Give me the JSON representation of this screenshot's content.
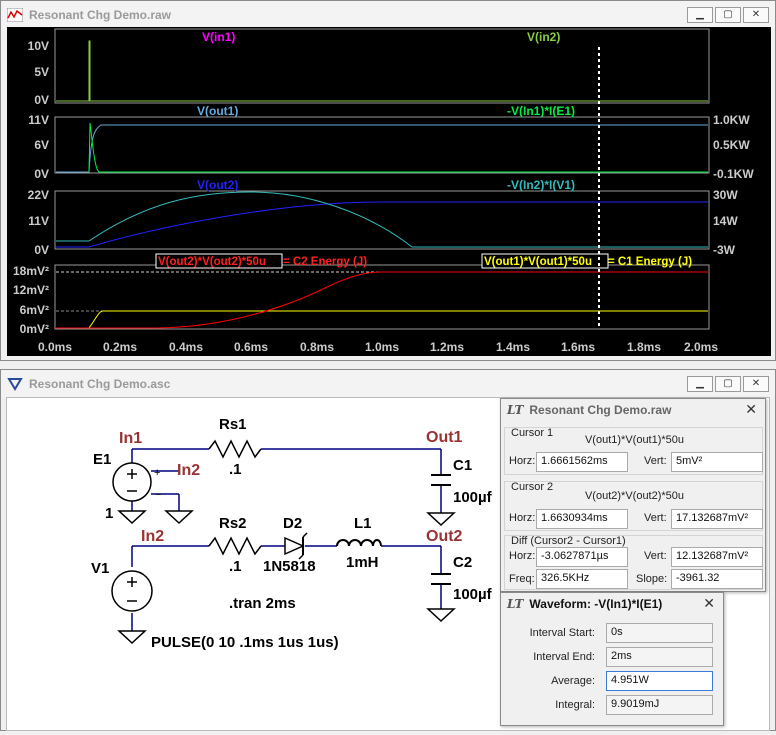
{
  "plot_window": {
    "title": "Resonant Chg Demo.raw",
    "buttons": [
      "minimize",
      "maximize",
      "close"
    ]
  },
  "pane1": {
    "left_trace": "V(in1)",
    "right_trace": "V(in2)",
    "left_ticks": [
      "10V",
      "5V",
      "0V"
    ]
  },
  "pane2": {
    "left_trace": "V(out1)",
    "right_trace": "-V(In1)*I(E1)",
    "left_ticks": [
      "11V",
      "6V",
      "0V"
    ],
    "right_ticks": [
      "1.0KW",
      "0.5KW",
      "-0.1KW"
    ]
  },
  "pane3": {
    "left_trace": "V(out2)",
    "right_trace": "-V(In2)*I(V1)",
    "left_ticks": [
      "22V",
      "11V",
      "0V"
    ],
    "right_ticks": [
      "30W",
      "14W",
      "-3W"
    ]
  },
  "pane4": {
    "left_trace_a": "V(out2)*V(out2)*50u",
    "left_trace_b": " = C2 Energy (J)",
    "right_trace_a": "V(out1)*V(out1)*50u",
    "right_trace_b": " = C1 Energy (J)",
    "left_ticks": [
      "18mV²",
      "12mV²",
      "6mV²",
      "0mV²"
    ]
  },
  "x_axis": {
    "ticks": [
      "0.0ms",
      "0.2ms",
      "0.4ms",
      "0.6ms",
      "0.8ms",
      "1.0ms",
      "1.2ms",
      "1.4ms",
      "1.6ms",
      "1.8ms",
      "2.0ms"
    ]
  },
  "colors": {
    "in1": "#ff00ff",
    "in2": "#88cc44",
    "out1": "#66aadd",
    "pe1": "#00ee44",
    "out2": "#2222ff",
    "pe2": "#33bbbb",
    "energy2": "#ff0000",
    "energy1": "#ffff00"
  },
  "schematic_window": {
    "title": "Resonant Chg Demo.asc",
    "buttons": [
      "minimize",
      "maximize",
      "close"
    ]
  },
  "schematic": {
    "nets": {
      "in1": "In1",
      "in2_e": "In2",
      "in2": "In2",
      "out1": "Out1",
      "out2": "Out2"
    },
    "parts": {
      "e1": "E1",
      "e1_gain": "1",
      "rs1": "Rs1",
      "rs1_val": ".1",
      "rs2": "Rs2",
      "rs2_val": ".1",
      "d2": "D2",
      "d2_val": "1N5818",
      "l1": "L1",
      "l1_val": "1mH",
      "c1": "C1",
      "c1_val": "100µf",
      "c2": "C2",
      "c2_val": "100µf",
      "v1": "V1",
      "v1_val": "PULSE(0 10 .1ms 1us 1us)"
    },
    "directive": ".tran 2ms"
  },
  "cursor_dialog": {
    "title": "Resonant Chg Demo.raw",
    "cursor1": {
      "label": "Cursor 1",
      "expr": "V(out1)*V(out1)*50u",
      "horz_label": "Horz:",
      "horz": "1.6661562ms",
      "vert_label": "Vert:",
      "vert": "5mV²"
    },
    "cursor2": {
      "label": "Cursor 2",
      "expr": "V(out2)*V(out2)*50u",
      "horz_label": "Horz:",
      "horz": "1.6630934ms",
      "vert_label": "Vert:",
      "vert": "17.132687mV²"
    },
    "diff": {
      "label": "Diff (Cursor2 - Cursor1)",
      "horz_label": "Horz:",
      "horz": "-3.0627871µs",
      "vert_label": "Vert:",
      "vert": "12.132687mV²",
      "freq_label": "Freq:",
      "freq": "326.5KHz",
      "slope_label": "Slope:",
      "slope": "-3961.32"
    }
  },
  "waveform_dialog": {
    "title": "Waveform: -V(In1)*I(E1)",
    "interval_start_label": "Interval Start:",
    "interval_start": "0s",
    "interval_end_label": "Interval End:",
    "interval_end": "2ms",
    "average_label": "Average:",
    "average": "4.951W",
    "integral_label": "Integral:",
    "integral": "9.9019mJ"
  }
}
